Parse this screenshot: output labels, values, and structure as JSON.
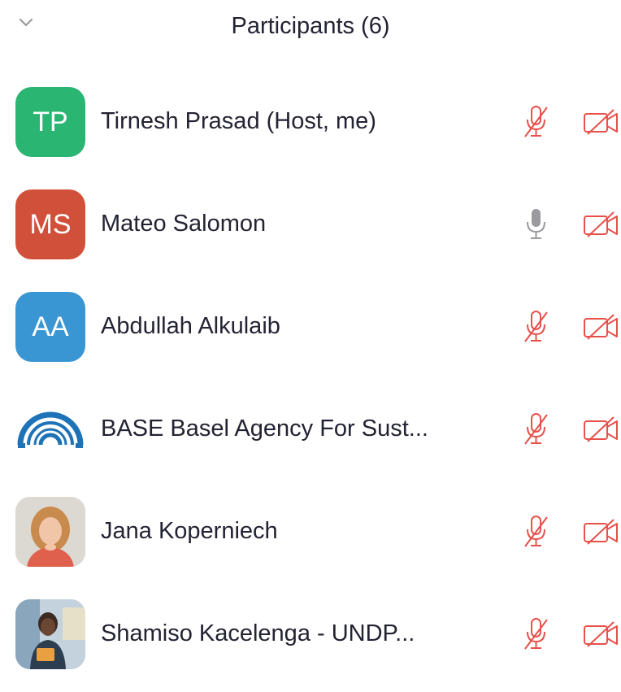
{
  "header": {
    "title": "Participants (6)",
    "collapse_icon": "chevron-down-icon"
  },
  "colors": {
    "muted_red": "#E8504A",
    "mic_gray": "#9a9a9f"
  },
  "participants": [
    {
      "name": "Tirnesh Prasad (Host, me)",
      "initials": "TP",
      "avatar_color": "#2BB573",
      "audio": "muted",
      "video": "off"
    },
    {
      "name": "Mateo Salomon",
      "initials": "MS",
      "avatar_color": "#D1503A",
      "audio": "unmuted",
      "video": "off"
    },
    {
      "name": "Abdullah Alkulaib",
      "initials": "AA",
      "avatar_color": "#3A96D2",
      "audio": "muted",
      "video": "off"
    },
    {
      "name": "BASE Basel Agency For Sust...",
      "initials": "",
      "avatar_color": "#1e73b8",
      "audio": "muted",
      "video": "off"
    },
    {
      "name": "Jana Koperniech",
      "initials": "",
      "avatar_color": "#c9a07c",
      "audio": "muted",
      "video": "off"
    },
    {
      "name": "Shamiso Kacelenga - UNDP...",
      "initials": "",
      "avatar_color": "#6a8aa8",
      "audio": "muted",
      "video": "off"
    }
  ]
}
